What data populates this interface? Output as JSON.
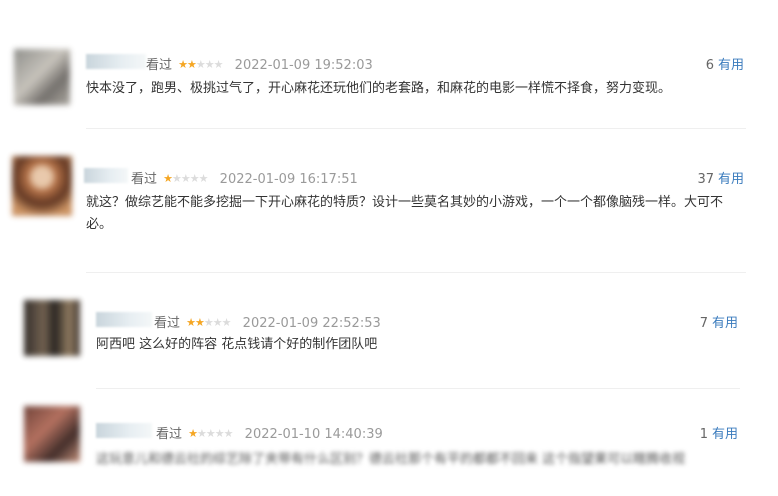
{
  "reviews": [
    {
      "seen_label": "看过",
      "rating": 2,
      "timestamp": "2022-01-09 19:52:03",
      "useful_count": "6",
      "useful_label": "有用",
      "content": "快本没了，跑男、极挑过气了，开心麻花还玩他们的老套路，和麻花的电影一样慌不择食，努力变现。"
    },
    {
      "seen_label": "看过",
      "rating": 1,
      "timestamp": "2022-01-09 16:17:51",
      "useful_count": "37",
      "useful_label": "有用",
      "content": "就这？做综艺能不能多挖掘一下开心麻花的特质？设计一些莫名其妙的小游戏，一个一个都像脑残一样。大可不必。"
    },
    {
      "seen_label": "看过",
      "rating": 2,
      "timestamp": "2022-01-09 22:52:53",
      "useful_count": "7",
      "useful_label": "有用",
      "content": "阿西吧 这么好的阵容 花点钱请个好的制作团队吧"
    },
    {
      "seen_label": "看过",
      "rating": 1,
      "timestamp": "2022-01-10 14:40:39",
      "useful_count": "1",
      "useful_label": "有用",
      "content": "这玩意儿和德云社的综艺除了夹带有什么区别？德云社那个有平的都都不回来 这个指望果可以瞎腾收视"
    }
  ],
  "colors": {
    "star_on": "#f5a623",
    "star_off": "#dcdcdc",
    "useful_link": "#3a7bbd"
  }
}
